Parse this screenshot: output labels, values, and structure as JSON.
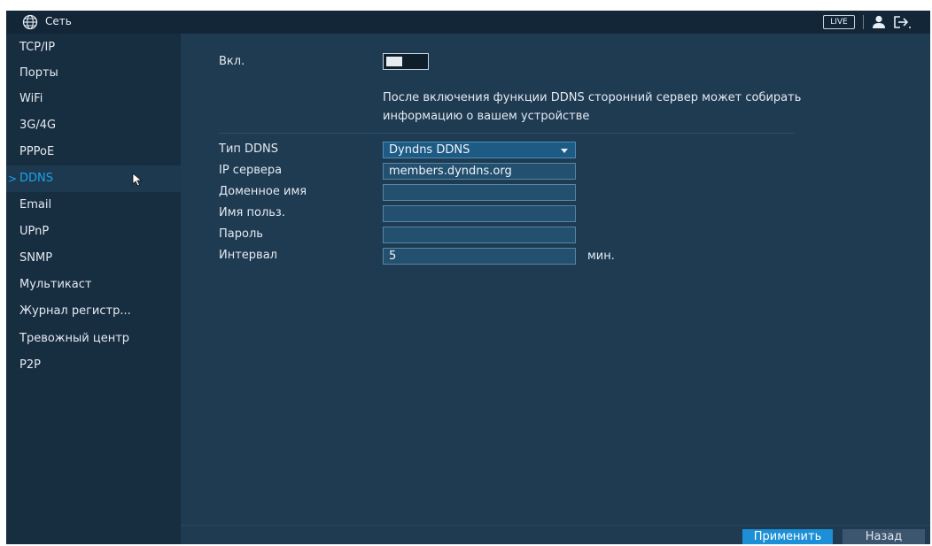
{
  "header": {
    "title": "Сеть",
    "live_label": "LIVE",
    "icons": [
      "globe-icon",
      "user-icon",
      "logout-icon"
    ]
  },
  "sidebar": {
    "items": [
      {
        "label": "TCP/IP"
      },
      {
        "label": "Порты"
      },
      {
        "label": "WiFi"
      },
      {
        "label": "3G/4G"
      },
      {
        "label": "PPPoE"
      },
      {
        "label": "DDNS",
        "active": true
      },
      {
        "label": "Email"
      },
      {
        "label": "UPnP"
      },
      {
        "label": "SNMP"
      },
      {
        "label": "Мультикаст"
      },
      {
        "label": "Журнал регистр..."
      },
      {
        "label": "Тревожный центр"
      },
      {
        "label": "P2P"
      }
    ],
    "active_chevron": ">"
  },
  "form": {
    "enable_label": "Вкл.",
    "enable_checked": false,
    "notice_line1": "После включения функции DDNS сторонний сервер может собирать",
    "notice_line2": "информацию о вашем устройстве",
    "ddns_type_label": "Тип DDNS",
    "ddns_type_value": "Dyndns DDNS",
    "server_ip_label": "IP сервера",
    "server_ip_value": "members.dyndns.org",
    "domain_label": "Доменное имя",
    "domain_value": "",
    "username_label": "Имя польз.",
    "username_value": "",
    "password_label": "Пароль",
    "password_value": "",
    "interval_label": "Интервал",
    "interval_value": "5",
    "interval_unit": "мин."
  },
  "buttons": {
    "apply": "Применить",
    "back": "Назад"
  },
  "colors": {
    "accent": "#1aa3e8",
    "background": "#1f3b52",
    "sidebar": "#172d40",
    "topbar": "#132637",
    "apply_button": "#1c8fd6"
  }
}
